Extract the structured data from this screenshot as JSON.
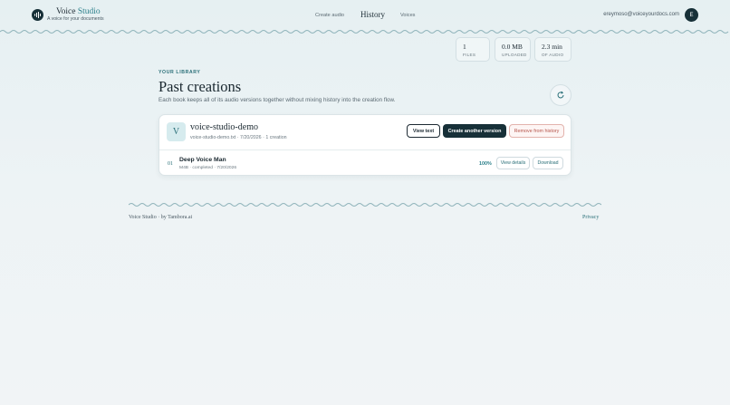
{
  "header": {
    "brand_name": "Voice",
    "brand_accent": "Studio",
    "tagline": "A voice for your documents",
    "nav": {
      "create": "Create audio",
      "history": "History",
      "voices": "Voices"
    },
    "email": "ereymoso@voiceyourdocs.com",
    "avatar_initial": "E"
  },
  "stats": {
    "files": {
      "value": "1",
      "label": "Files"
    },
    "uploaded": {
      "value": "0.0 MB",
      "label": "Uploaded"
    },
    "audio": {
      "value": "2.3 min",
      "label": "Of audio"
    }
  },
  "library": {
    "eyebrow": "YOUR LIBRARY",
    "title": "Past creations",
    "subtitle": "Each book keeps all of its audio versions together without mixing history into the creation flow."
  },
  "book": {
    "initial": "V",
    "name": "voice-studio-demo",
    "meta": "voice-studio-demo.txt · 7/20/2026 · 1 creation",
    "buttons": {
      "view_text": "View text",
      "create_another": "Create another version",
      "remove": "Remove from history"
    },
    "creations": [
      {
        "index": "01",
        "title": "Deep Voice Man",
        "meta": "M4B · completed · 7/20/2026",
        "progress": "100%",
        "view_details": "View details",
        "download": "Download"
      }
    ]
  },
  "footer": {
    "credit": "Voice Studio · by Tambora.ai",
    "privacy": "Privacy"
  },
  "colors": {
    "brand_dark": "#173038",
    "accent": "#2a7f8a",
    "danger": "#b5544a"
  },
  "icons": {
    "logo": "audio-wave-icon",
    "refresh": "refresh-icon"
  }
}
